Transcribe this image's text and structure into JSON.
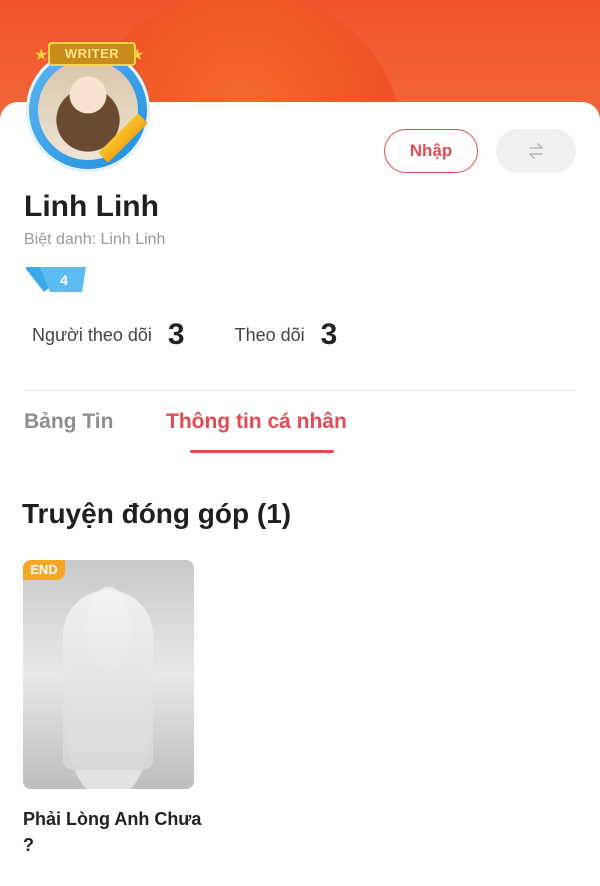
{
  "profile": {
    "writer_badge": "WRITER",
    "name": "Linh Linh",
    "nickname": "Biệt danh: Linh Linh",
    "level": "4"
  },
  "actions": {
    "import_label": "Nhập",
    "switch_icon": "swap-icon"
  },
  "stats": {
    "followers_label": "Người theo dõi",
    "followers_count": "3",
    "following_label": "Theo dõi",
    "following_count": "3"
  },
  "tabs": [
    {
      "label": "Bảng Tin",
      "active": false
    },
    {
      "label": "Thông tin cá nhân",
      "active": true
    }
  ],
  "contributions": {
    "title": "Truyện đóng góp (1)",
    "books": [
      {
        "title": "Phải Lòng Anh Chưa ?",
        "status": "END"
      }
    ]
  },
  "colors": {
    "header": "#f2542c",
    "accent": "#e44a55",
    "end_tag": "#f5a623",
    "level_badge": "#3aa8ea"
  }
}
